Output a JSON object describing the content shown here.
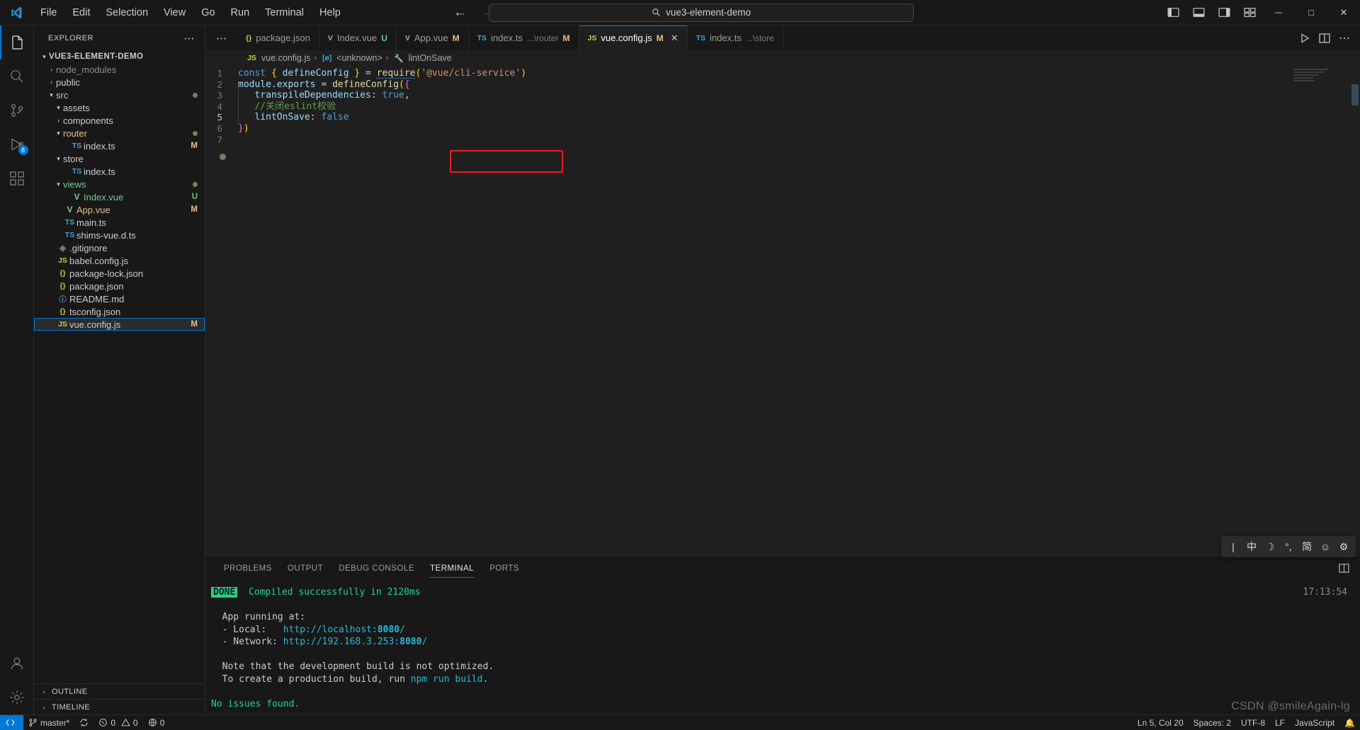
{
  "window": {
    "search_value": "vue3-element-demo",
    "menu": [
      "File",
      "Edit",
      "Selection",
      "View",
      "Go",
      "Run",
      "Terminal",
      "Help"
    ],
    "back_icon": "arrow-left-icon",
    "forward_icon": "arrow-right-icon",
    "minimize_label": "─",
    "maximize_label": "□",
    "close_label": "✕"
  },
  "activitybar": {
    "items": [
      {
        "name": "explorer",
        "icon": "files-icon",
        "active": true,
        "badge": ""
      },
      {
        "name": "search",
        "icon": "search-icon",
        "active": false,
        "badge": ""
      },
      {
        "name": "source-control",
        "icon": "source-control-icon",
        "active": false,
        "badge": ""
      },
      {
        "name": "run-and-debug",
        "icon": "debug-icon",
        "active": false,
        "badge": "8"
      },
      {
        "name": "extensions",
        "icon": "extensions-icon",
        "active": false,
        "badge": ""
      }
    ],
    "bottom": [
      {
        "name": "accounts",
        "icon": "account-icon"
      },
      {
        "name": "settings",
        "icon": "gear-icon"
      }
    ]
  },
  "sidebar": {
    "title": "EXPLORER",
    "more_label": "⋯",
    "root": "VUE3-ELEMENT-DEMO",
    "tree": [
      {
        "label": "node_modules",
        "indent": 1,
        "chev": "›",
        "icon": "",
        "color": "dim",
        "badge": ""
      },
      {
        "label": "public",
        "indent": 1,
        "chev": "›",
        "icon": "",
        "color": "",
        "badge": ""
      },
      {
        "label": "src",
        "indent": 1,
        "chev": "⌄",
        "icon": "",
        "color": "orange",
        "badge": "dot"
      },
      {
        "label": "assets",
        "indent": 2,
        "chev": "⌄",
        "icon": "",
        "color": "",
        "badge": ""
      },
      {
        "label": "components",
        "indent": 2,
        "chev": "›",
        "icon": "",
        "color": "",
        "badge": ""
      },
      {
        "label": "router",
        "indent": 2,
        "chev": "⌄",
        "icon": "",
        "color": "orange",
        "badge": "dot"
      },
      {
        "label": "index.ts",
        "indent": 3,
        "chev": "",
        "icon": "ts",
        "color": "",
        "badge": "M"
      },
      {
        "label": "store",
        "indent": 2,
        "chev": "⌄",
        "icon": "",
        "color": "",
        "badge": ""
      },
      {
        "label": "index.ts",
        "indent": 3,
        "chev": "",
        "icon": "ts",
        "color": "",
        "badge": ""
      },
      {
        "label": "views",
        "indent": 2,
        "chev": "⌄",
        "icon": "",
        "color": "green",
        "badge": "dot"
      },
      {
        "label": "Index.vue",
        "indent": 3,
        "chev": "",
        "icon": "vue",
        "color": "green",
        "badge": "U"
      },
      {
        "label": "App.vue",
        "indent": 2,
        "chev": "",
        "icon": "vue",
        "color": "orange",
        "badge": "M"
      },
      {
        "label": "main.ts",
        "indent": 2,
        "chev": "",
        "icon": "ts",
        "color": "",
        "badge": ""
      },
      {
        "label": "shims-vue.d.ts",
        "indent": 2,
        "chev": "",
        "icon": "ts",
        "color": "",
        "badge": ""
      },
      {
        "label": ".gitignore",
        "indent": 1,
        "chev": "",
        "icon": "gitig",
        "color": "",
        "badge": ""
      },
      {
        "label": "babel.config.js",
        "indent": 1,
        "chev": "",
        "icon": "js",
        "color": "",
        "badge": ""
      },
      {
        "label": "package-lock.json",
        "indent": 1,
        "chev": "",
        "icon": "json",
        "color": "",
        "badge": ""
      },
      {
        "label": "package.json",
        "indent": 1,
        "chev": "",
        "icon": "json",
        "color": "",
        "badge": ""
      },
      {
        "label": "README.md",
        "indent": 1,
        "chev": "",
        "icon": "md",
        "color": "",
        "badge": ""
      },
      {
        "label": "tsconfig.json",
        "indent": 1,
        "chev": "",
        "icon": "json",
        "color": "",
        "badge": ""
      },
      {
        "label": "vue.config.js",
        "indent": 1,
        "chev": "",
        "icon": "js",
        "color": "",
        "badge": "M",
        "selected": true
      }
    ],
    "sections": [
      {
        "label": "OUTLINE",
        "chev": "›"
      },
      {
        "label": "TIMELINE",
        "chev": "›"
      }
    ]
  },
  "tabs": {
    "overflow_label": "⋯",
    "items": [
      {
        "icon": "{}",
        "icon_class": "json",
        "name": "package.json",
        "sub": "",
        "badge": "",
        "active": false
      },
      {
        "icon": "V",
        "icon_class": "vue",
        "name": "Index.vue",
        "sub": "",
        "badge": "U",
        "active": false
      },
      {
        "icon": "V",
        "icon_class": "vue",
        "name": "App.vue",
        "sub": "",
        "badge": "M",
        "active": false
      },
      {
        "icon": "TS",
        "icon_class": "ts",
        "name": "index.ts",
        "sub": "...\\router",
        "badge": "M",
        "active": false
      },
      {
        "icon": "JS",
        "icon_class": "js",
        "name": "vue.config.js",
        "sub": "",
        "badge": "M",
        "active": true,
        "close": "✕"
      },
      {
        "icon": "TS",
        "icon_class": "ts",
        "name": "index.ts",
        "sub": "...\\store",
        "badge": "",
        "active": false
      }
    ],
    "actions": [
      "split-editor-icon",
      "layout-panel-icon",
      "more-actions-icon"
    ]
  },
  "breadcrumb": {
    "items": [
      {
        "icon": "JS",
        "icon_class": "js",
        "label": "vue.config.js"
      },
      {
        "icon": "[ø]",
        "icon_class": "ts",
        "label": "<unknown>"
      },
      {
        "icon": "🔧",
        "icon_class": "",
        "label": "lintOnSave"
      }
    ],
    "sep": "›"
  },
  "code": {
    "lines": [
      {
        "n": "1",
        "tokens": [
          {
            "t": "const ",
            "c": "kw"
          },
          {
            "t": "{ ",
            "c": "br1"
          },
          {
            "t": "defineConfig",
            "c": "var"
          },
          {
            "t": " }",
            "c": "br1"
          },
          {
            "t": " = ",
            "c": "punc"
          },
          {
            "t": "require",
            "c": "fn squig"
          },
          {
            "t": "(",
            "c": "br1"
          },
          {
            "t": "'@vue/cli-service'",
            "c": "str"
          },
          {
            "t": ")",
            "c": "br1"
          }
        ]
      },
      {
        "n": "2",
        "tokens": [
          {
            "t": "module",
            "c": "var"
          },
          {
            "t": ".",
            "c": "punc"
          },
          {
            "t": "exports",
            "c": "var"
          },
          {
            "t": " = ",
            "c": "punc"
          },
          {
            "t": "defineConfig",
            "c": "fn"
          },
          {
            "t": "(",
            "c": "br1"
          },
          {
            "t": "{",
            "c": "br2"
          }
        ]
      },
      {
        "n": "3",
        "indent": 1,
        "tokens": [
          {
            "t": "  transpileDependencies",
            "c": "var"
          },
          {
            "t": ": ",
            "c": "punc"
          },
          {
            "t": "true",
            "c": "kw"
          },
          {
            "t": ",",
            "c": "punc"
          }
        ]
      },
      {
        "n": "4",
        "indent": 1,
        "tokens": [
          {
            "t": "  //关闭eslint校验",
            "c": "cmt"
          }
        ]
      },
      {
        "n": "5",
        "indent": 1,
        "current": true,
        "tokens": [
          {
            "t": "  lintOnSave",
            "c": "var"
          },
          {
            "t": ": ",
            "c": "punc"
          },
          {
            "t": "false",
            "c": "kw"
          }
        ]
      },
      {
        "n": "6",
        "tokens": [
          {
            "t": "}",
            "c": "br2"
          },
          {
            "t": ")",
            "c": "br1"
          }
        ]
      },
      {
        "n": "7",
        "tokens": []
      }
    ]
  },
  "panel": {
    "tabs": [
      "PROBLEMS",
      "OUTPUT",
      "DEBUG CONSOLE",
      "TERMINAL",
      "PORTS"
    ],
    "active_tab": "TERMINAL",
    "terminal": {
      "clock": "17:13:54",
      "done_badge": "DONE",
      "lines": [
        {
          "segs": [
            {
              "t": "DONE",
              "c": "tdone"
            },
            {
              "t": "  Compiled successfully in 2120ms",
              "c": "tgreen"
            }
          ],
          "indent": 1
        },
        {
          "segs": []
        },
        {
          "segs": [
            {
              "t": "  App running at:",
              "c": ""
            }
          ]
        },
        {
          "segs": [
            {
              "t": "  - Local:   ",
              "c": ""
            },
            {
              "t": "http://localhost:",
              "c": "tcyan"
            },
            {
              "t": "8080",
              "c": "tcyanb"
            },
            {
              "t": "/",
              "c": "tcyan"
            }
          ]
        },
        {
          "segs": [
            {
              "t": "  - Network: ",
              "c": ""
            },
            {
              "t": "http://192.168.3.253:",
              "c": "tcyan"
            },
            {
              "t": "8080",
              "c": "tcyanb"
            },
            {
              "t": "/",
              "c": "tcyan"
            }
          ]
        },
        {
          "segs": []
        },
        {
          "segs": [
            {
              "t": "  Note that the development build is not optimized.",
              "c": ""
            }
          ]
        },
        {
          "segs": [
            {
              "t": "  To create a production build, run ",
              "c": ""
            },
            {
              "t": "npm run build",
              "c": "tcyan"
            },
            {
              "t": ".",
              "c": ""
            }
          ]
        },
        {
          "segs": []
        },
        {
          "segs": [
            {
              "t": "No issues found.",
              "c": "tgreen"
            }
          ]
        }
      ]
    },
    "ime": [
      "中",
      "☽",
      "°,",
      "简",
      "☺",
      "⚙"
    ]
  },
  "statusbar": {
    "remote_label": "",
    "branch": "master*",
    "sync_icon": "sync-icon",
    "errors": "0",
    "warnings": "0",
    "ports": "0",
    "cursor": "Ln 5, Col 20",
    "spaces": "Spaces: 2",
    "encoding": "UTF-8",
    "eol": "LF",
    "language": "JavaScript",
    "bell": "🔔"
  },
  "watermark": "CSDN @smileAgain-lg"
}
